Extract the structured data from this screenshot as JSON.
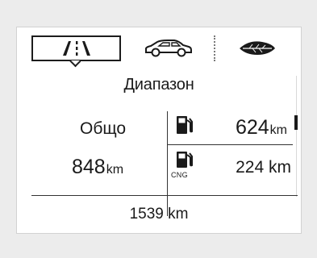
{
  "tabs": [
    {
      "label": "",
      "icon": "road-icon",
      "selected": true
    },
    {
      "label": "",
      "icon": "car-icon",
      "selected": false
    },
    {
      "label": "",
      "icon": "leaf-icon",
      "selected": false
    }
  ],
  "range": {
    "title": "Диапазон",
    "total_label": "Общо",
    "total_value": "848",
    "total_unit": "km",
    "fuel_value": "624",
    "fuel_unit": "km",
    "fuel_icon": "fuel-pump-icon",
    "cng_value": "224 km",
    "cng_label": "CNG",
    "cng_icon": "cng-pump-icon"
  },
  "odometer": "1539 km"
}
